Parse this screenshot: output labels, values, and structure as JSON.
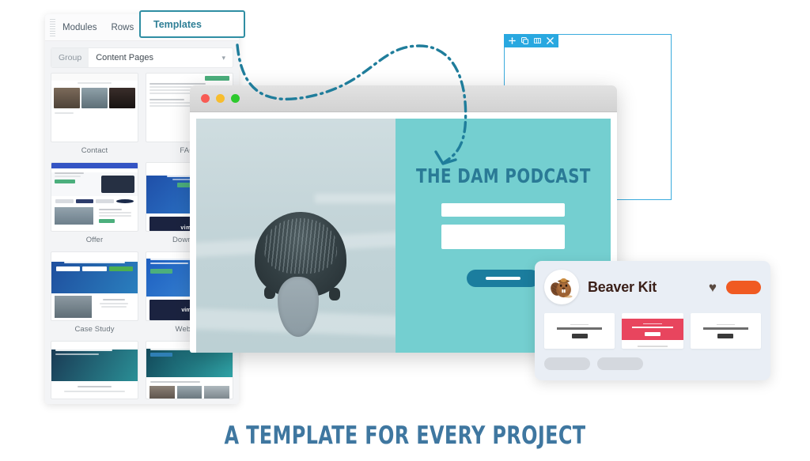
{
  "panel": {
    "drag_handle": "drag-handle",
    "tabs": [
      {
        "label": "Modules",
        "active": false
      },
      {
        "label": "Rows",
        "active": false
      },
      {
        "label": "Templates",
        "active": true
      }
    ],
    "group": {
      "label": "Group",
      "value": "Content Pages",
      "chevron": "⌄"
    },
    "templates": [
      {
        "label": "Contact"
      },
      {
        "label": "FAQs"
      },
      {
        "label": "Offer"
      },
      {
        "label": "Download"
      },
      {
        "label": "Case Study"
      },
      {
        "label": "Webinar"
      }
    ]
  },
  "blue_box": {
    "border_color": "#3aabdd",
    "toolbar_bg": "#29a8e0",
    "toolbar_icons": [
      "move-icon",
      "duplicate-icon",
      "columns-icon",
      "close-icon"
    ]
  },
  "browser": {
    "traffic_lights": [
      {
        "name": "close-dot",
        "color": "#f85b54"
      },
      {
        "name": "minimize-dot",
        "color": "#f7bd2e"
      },
      {
        "name": "maximize-dot",
        "color": "#2dc92d"
      }
    ],
    "photo_alt": "beaver-on-ice-photo",
    "panel": {
      "bg_color": "#74cfd0",
      "title": "THE DAM PODCAST",
      "title_color": "#2a7a96",
      "fields": [
        "name-field",
        "message-field"
      ],
      "cta": {
        "name": "submit-button",
        "color": "#1b7d9e"
      }
    }
  },
  "beaver_kit": {
    "logo_alt": "beaver-mascot-logo",
    "name": "Beaver Kit",
    "heart": "♥",
    "heart_color": "#5a4a40",
    "pill_color": "#f05a22",
    "mini_cards": [
      {
        "variant": "plain"
      },
      {
        "variant": "red",
        "accent": "#e8455e"
      },
      {
        "variant": "plain"
      }
    ],
    "placeholder_pills": 2
  },
  "arrow": {
    "name": "dashed-pointer-arrow",
    "color": "#1f7d9b"
  },
  "caption": {
    "text": "A TEMPLATE FOR EVERY PROJECT",
    "color": "#3f77a0"
  }
}
